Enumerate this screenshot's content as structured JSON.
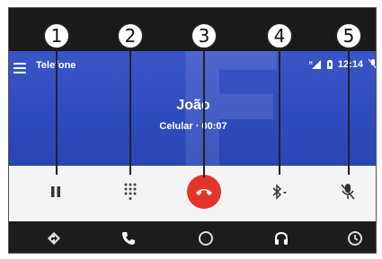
{
  "app": {
    "title": "Telefone"
  },
  "status_bar": {
    "time": "12:14"
  },
  "call": {
    "contact_name": "João",
    "status_text": "Celular · 00:07",
    "background_initial": "F"
  },
  "controls": [
    {
      "id": "pause",
      "icon": "pause-icon"
    },
    {
      "id": "keypad",
      "icon": "dialpad-icon"
    },
    {
      "id": "end_call",
      "icon": "end-call-icon"
    },
    {
      "id": "bluetooth",
      "icon": "bluetooth-icon"
    },
    {
      "id": "mute",
      "icon": "mic-off-icon"
    }
  ],
  "nav": [
    "navigation-icon",
    "phone-icon",
    "home-icon",
    "headphones-icon",
    "recent-icon"
  ],
  "callouts": [
    "1",
    "2",
    "3",
    "4",
    "5"
  ],
  "colors": {
    "header_blue": "#3a55c8",
    "end_call_red": "#e5352b",
    "controls_bg": "#f4f4f4",
    "nav_bg": "#1c1c1f"
  }
}
